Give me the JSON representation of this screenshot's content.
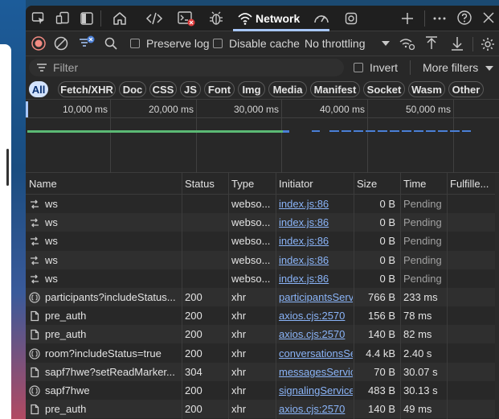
{
  "tabs": {
    "network_label": "Network"
  },
  "toolbar": {
    "preserve_log": "Preserve log",
    "disable_cache": "Disable cache",
    "throttling": "No throttling"
  },
  "filter": {
    "placeholder": "Filter",
    "invert": "Invert",
    "more_filters": "More filters"
  },
  "type_filters": [
    "All",
    "Fetch/XHR",
    "Doc",
    "CSS",
    "JS",
    "Font",
    "Img",
    "Media",
    "Manifest",
    "Socket",
    "Wasm",
    "Other"
  ],
  "timeline": {
    "ticks": [
      "10,000 ms",
      "20,000 ms",
      "30,000 ms",
      "40,000 ms",
      "50,000 ms"
    ]
  },
  "columns": [
    "Name",
    "Status",
    "Type",
    "Initiator",
    "Size",
    "Time",
    "Fulfille..."
  ],
  "rows": [
    {
      "icon": "websocket-icon",
      "name": "ws",
      "status": "",
      "type": "webso...",
      "initiator": "index.js:86",
      "size": "0 B",
      "time": "Pending"
    },
    {
      "icon": "websocket-icon",
      "name": "ws",
      "status": "",
      "type": "webso...",
      "initiator": "index.js:86",
      "size": "0 B",
      "time": "Pending"
    },
    {
      "icon": "websocket-icon",
      "name": "ws",
      "status": "",
      "type": "webso...",
      "initiator": "index.js:86",
      "size": "0 B",
      "time": "Pending"
    },
    {
      "icon": "websocket-icon",
      "name": "ws",
      "status": "",
      "type": "webso...",
      "initiator": "index.js:86",
      "size": "0 B",
      "time": "Pending"
    },
    {
      "icon": "websocket-icon",
      "name": "ws",
      "status": "",
      "type": "webso...",
      "initiator": "index.js:86",
      "size": "0 B",
      "time": "Pending"
    },
    {
      "icon": "json-icon",
      "name": "participants?includeStatus...",
      "status": "200",
      "type": "xhr",
      "initiator": "participantsServ",
      "size": "766 B",
      "time": "233 ms"
    },
    {
      "icon": "document-icon",
      "name": "pre_auth",
      "status": "200",
      "type": "xhr",
      "initiator": "axios.cjs:2570",
      "size": "156 B",
      "time": "78 ms"
    },
    {
      "icon": "document-icon",
      "name": "pre_auth",
      "status": "200",
      "type": "xhr",
      "initiator": "axios.cjs:2570",
      "size": "140 B",
      "time": "82 ms"
    },
    {
      "icon": "json-icon",
      "name": "room?includeStatus=true",
      "status": "200",
      "type": "xhr",
      "initiator": "conversationsSe",
      "size": "4.4 kB",
      "time": "2.40 s"
    },
    {
      "icon": "document-icon",
      "name": "sapf7hwe?setReadMarker...",
      "status": "304",
      "type": "xhr",
      "initiator": "messagesServic",
      "size": "70 B",
      "time": "30.07 s"
    },
    {
      "icon": "json-icon",
      "name": "sapf7hwe",
      "status": "200",
      "type": "xhr",
      "initiator": "signalingService",
      "size": "483 B",
      "time": "30.13 s"
    },
    {
      "icon": "document-icon",
      "name": "pre_auth",
      "status": "200",
      "type": "xhr",
      "initiator": "axios.cjs:2570",
      "size": "140 B",
      "time": "49 ms"
    }
  ],
  "colors": {
    "panel_bg": "#282828",
    "link": "#8ab4f8",
    "record_red": "#f28b82",
    "active_chip": "#d3e3fd",
    "waterfall_green": "#5bb974",
    "waterfall_blue": "#4a7fd6"
  }
}
